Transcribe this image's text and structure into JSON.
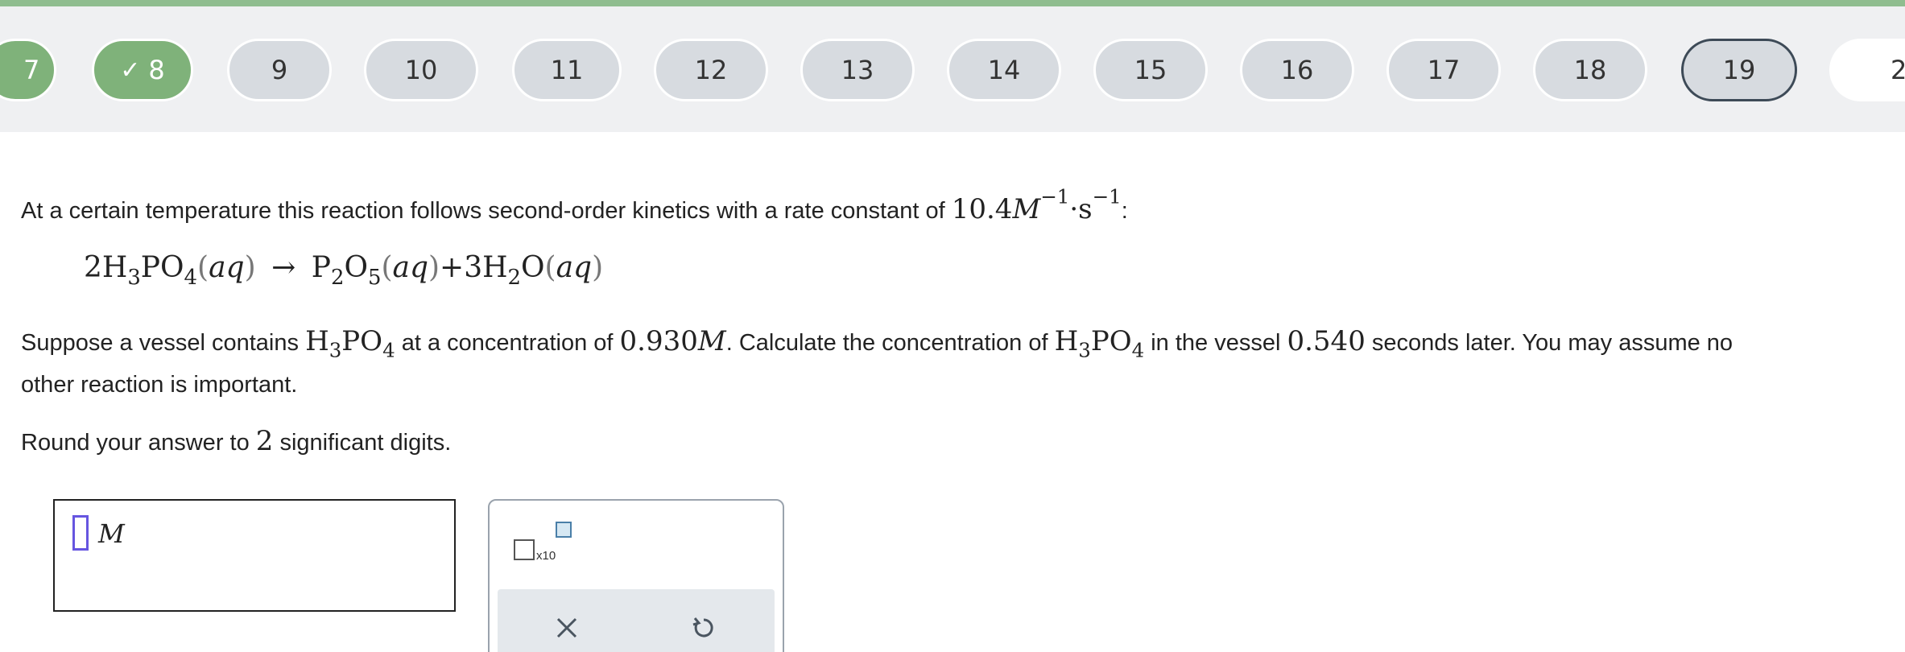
{
  "nav": {
    "items": [
      {
        "label": "7",
        "state": "completed"
      },
      {
        "label": "8",
        "state": "completed"
      },
      {
        "label": "9",
        "state": "default"
      },
      {
        "label": "10",
        "state": "default"
      },
      {
        "label": "11",
        "state": "default"
      },
      {
        "label": "12",
        "state": "default"
      },
      {
        "label": "13",
        "state": "default"
      },
      {
        "label": "14",
        "state": "default"
      },
      {
        "label": "15",
        "state": "default"
      },
      {
        "label": "16",
        "state": "default"
      },
      {
        "label": "17",
        "state": "default"
      },
      {
        "label": "18",
        "state": "default"
      },
      {
        "label": "19",
        "state": "current"
      },
      {
        "label": "2",
        "state": "default"
      }
    ],
    "check_icon": "✓"
  },
  "question": {
    "intro_text": "At a certain temperature this reaction follows second-order kinetics with a rate constant of ",
    "rate_value": "10.4",
    "rate_unit_M": "M",
    "rate_exp1": "−1",
    "rate_dot": "·",
    "rate_unit_s": "s",
    "rate_exp2": "−1",
    "rate_end": ":",
    "equation": {
      "coef1": "2",
      "reactant": {
        "p1": "H",
        "s1": "3",
        "p2": "PO",
        "s2": "4"
      },
      "state1": "aq",
      "arrow": "→",
      "product1": {
        "p1": "P",
        "s1": "2",
        "p2": "O",
        "s2": "5"
      },
      "state2": "aq",
      "plus": "+",
      "coef2": "3",
      "product2": {
        "p1": "H",
        "s1": "2",
        "p2": "O"
      },
      "state3": "aq"
    },
    "para_part1": "Suppose a vessel contains ",
    "species_p1": "H",
    "species_s1": "3",
    "species_p2": "PO",
    "species_s2": "4",
    "para_part2": " at a concentration of ",
    "conc_value": "0.930",
    "conc_unit": "M",
    "para_part3": ". Calculate the concentration of ",
    "para_part4": " in the vessel ",
    "time_value": "0.540",
    "para_part5": " seconds later. You may assume no",
    "para_line2": "other reaction is important.",
    "round_part1": "Round your answer to ",
    "round_digits": "2",
    "round_part2": " significant digits."
  },
  "answer": {
    "unit": "M"
  },
  "tools": {
    "x10_label": "x10",
    "clear_icon": "close-icon",
    "undo_icon": "undo-icon"
  }
}
